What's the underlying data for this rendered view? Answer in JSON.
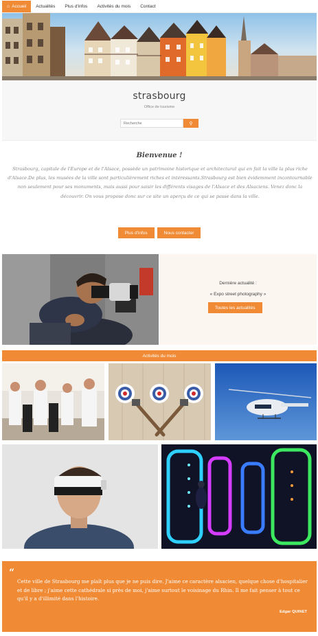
{
  "nav": {
    "items": [
      {
        "label": "Accueil",
        "icon": "home-icon",
        "active": true
      },
      {
        "label": "Actualités"
      },
      {
        "label": "Plus d'infos"
      },
      {
        "label": "Activités du mois"
      },
      {
        "label": "Contact"
      }
    ]
  },
  "header": {
    "title": "strasbourg",
    "subtitle": "Office de tourisme",
    "search": {
      "placeholder": "Recherche"
    }
  },
  "welcome": {
    "title": "Bienvenue !",
    "text": "Strasbourg, capitale de l'Europe et de l'Alsace, possède un patrimoine historique et architectural qui en fait la ville la plus riche d'Alsace.De plus, les musées de la ville sont particulièrement riches et intéressants.Strasbourg est bien évidemment incontournable non seulement pour ses monuments, mais aussi pour saisir les différents visages de l'Alsace et des Alsaciens. Venez donc la découvrir. On vous propose donc sur ce site un aperçu de ce qui se passe dans la ville.",
    "buttons": {
      "more_info": "Plus d'infos",
      "contact": "Nous contacter"
    }
  },
  "news": {
    "label": "Dernière actualité :",
    "item": "« Expo street photography »",
    "button": "Toutes les actualités"
  },
  "activities": {
    "title": "Activités du mois"
  },
  "quote": {
    "text": "Cette ville de Strasbourg me plaît plus que je ne puis dire. J'aime ce caractère alsacien, quelque chose d'hospitalier et de libre ; j'aime cette cathédrale si près de moi, j'aime surtout le voisinage du Rhin. Il me fait penser à tout ce qu'il y a d'illimité dans l'histoire.",
    "author": "Edgar QUINET"
  },
  "colors": {
    "accent": "#f08a35",
    "panel": "#fbf7f0",
    "header_bg": "#f7f7f7"
  }
}
